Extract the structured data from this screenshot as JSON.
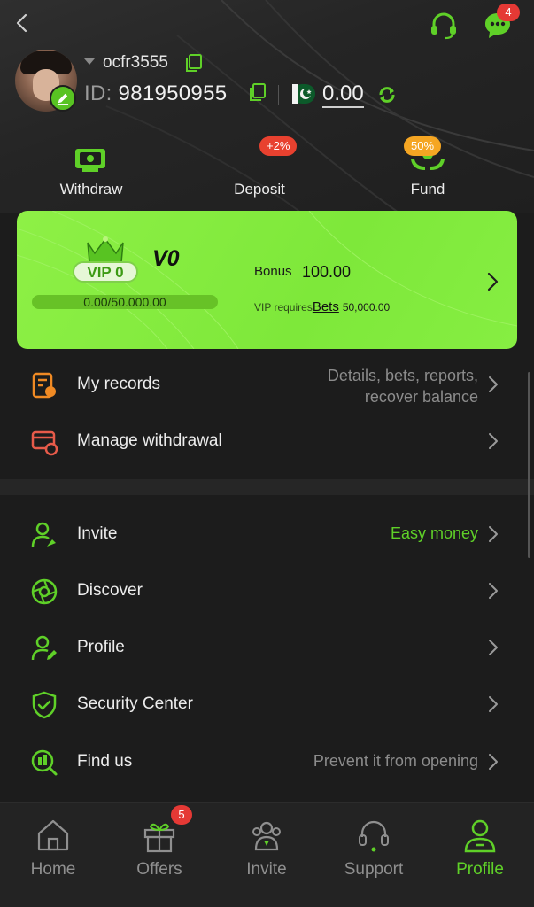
{
  "header": {
    "username": "ocfr3555",
    "id_label": "ID:",
    "id_value": "981950955",
    "balance": "0.00",
    "chat_badge": "4"
  },
  "actions": [
    {
      "label": "Withdraw",
      "badge": ""
    },
    {
      "label": "Deposit",
      "badge": "+2%"
    },
    {
      "label": "Fund",
      "badge": "50%"
    }
  ],
  "vip": {
    "level": "V0",
    "emblem_text": "VIP 0",
    "progress_text": "0.00/50.000.00",
    "progress_fraction": 0,
    "bonus_label": "Bonus",
    "bonus_value": "100.00",
    "requires_label": "VIP requires",
    "requires_link": "Bets",
    "requires_amount": "50,000.00"
  },
  "menu_top": [
    {
      "label": "My records",
      "hint_line1": "Details, bets, reports,",
      "hint_line2": "recover balance",
      "icon": "records-icon"
    },
    {
      "label": "Manage withdrawal",
      "hint_line1": "",
      "hint_line2": "",
      "icon": "withdrawal-icon"
    }
  ],
  "menu_bottom": [
    {
      "label": "Invite",
      "hint": "Easy money",
      "icon": "invite-icon"
    },
    {
      "label": "Discover",
      "hint": "",
      "icon": "discover-icon"
    },
    {
      "label": "Profile",
      "hint": "",
      "icon": "profile-edit-icon"
    },
    {
      "label": "Security Center",
      "hint": "",
      "icon": "shield-icon"
    },
    {
      "label": "Find us",
      "hint": "Prevent it from opening",
      "icon": "find-us-icon"
    }
  ],
  "tabs": [
    {
      "label": "Home",
      "icon": "home-icon"
    },
    {
      "label": "Offers",
      "icon": "gift-icon",
      "badge": "5"
    },
    {
      "label": "Invite",
      "icon": "invite-people-icon"
    },
    {
      "label": "Support",
      "icon": "headset-icon"
    },
    {
      "label": "Profile",
      "icon": "profile-icon",
      "active": true
    }
  ],
  "colors": {
    "accent": "#5fd028",
    "vip_card": "#86ee42",
    "badge_red": "#e53935",
    "badge_orange": "#f5a623",
    "records_orange": "#f08a24",
    "withdrawal_red": "#e85b4a"
  }
}
